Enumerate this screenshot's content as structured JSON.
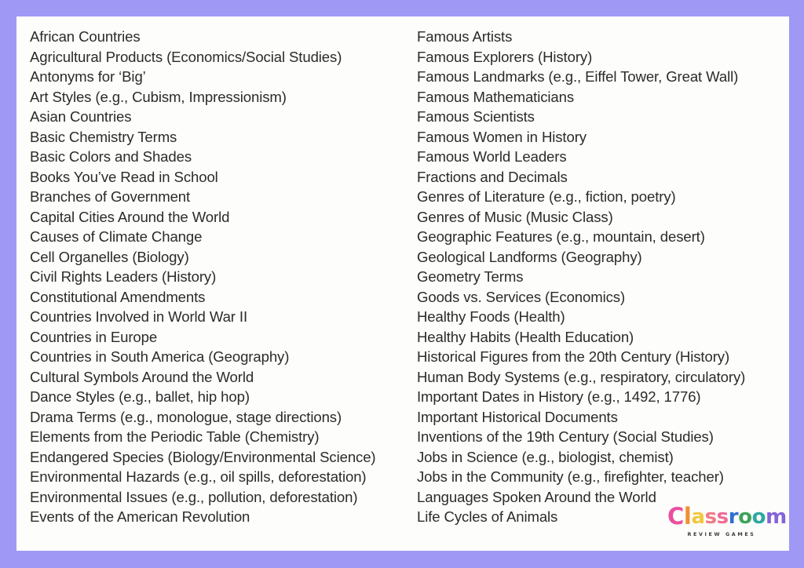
{
  "page": {
    "background_color": "#a098f5",
    "card_color": "#fdfdfb",
    "text_color": "#2b2b2b"
  },
  "columns": {
    "left": [
      "African Countries",
      "Agricultural Products (Economics/Social Studies)",
      "Antonyms for ‘Big’",
      "Art Styles (e.g., Cubism, Impressionism)",
      "Asian Countries",
      "Basic Chemistry Terms",
      "Basic Colors and Shades",
      "Books You’ve Read in School",
      "Branches of Government",
      "Capital Cities Around the World",
      "Causes of Climate Change",
      "Cell Organelles (Biology)",
      "Civil Rights Leaders (History)",
      "Constitutional Amendments",
      "Countries Involved in World War II",
      "Countries in Europe",
      "Countries in South America (Geography)",
      "Cultural Symbols Around the World",
      "Dance Styles (e.g., ballet, hip hop)",
      "Drama Terms (e.g., monologue, stage directions)",
      "Elements from the Periodic Table (Chemistry)",
      "Endangered Species (Biology/Environmental Science)",
      "Environmental Hazards (e.g., oil spills, deforestation)",
      "Environmental Issues (e.g., pollution, deforestation)",
      "Events of the American Revolution"
    ],
    "right": [
      "Famous Artists",
      "Famous Explorers (History)",
      "Famous Landmarks (e.g., Eiffel Tower, Great Wall)",
      "Famous Mathematicians",
      "Famous Scientists",
      "Famous Women in History",
      "Famous World Leaders",
      "Fractions and Decimals",
      "Genres of Literature (e.g., fiction, poetry)",
      "Genres of Music (Music Class)",
      "Geographic Features (e.g., mountain, desert)",
      "Geological Landforms (Geography)",
      "Geometry Terms",
      "Goods vs. Services (Economics)",
      "Healthy Foods (Health)",
      "Healthy Habits (Health Education)",
      "Historical Figures from the 20th Century (History)",
      "Human Body Systems (e.g., respiratory, circulatory)",
      "Important Dates in History (e.g., 1492, 1776)",
      "Important Historical Documents",
      "Inventions of the 19th Century (Social Studies)",
      "Jobs in Science (e.g., biologist, chemist)",
      "Jobs in the Community (e.g., firefighter, teacher)",
      "Languages Spoken Around the World",
      "Life Cycles of Animals"
    ]
  },
  "logo": {
    "word": "Classroom",
    "tagline": "REVIEW GAMES",
    "letters": [
      {
        "char": "C",
        "color": "#ea4f9e",
        "tall": true
      },
      {
        "char": "l",
        "color": "#f0902f",
        "tall": true
      },
      {
        "char": "a",
        "color": "#f2c73c",
        "tall": false
      },
      {
        "char": "s",
        "color": "#f07a84",
        "tall": false
      },
      {
        "char": "s",
        "color": "#ef6b93",
        "tall": false
      },
      {
        "char": "r",
        "color": "#2f6fd0",
        "tall": false
      },
      {
        "char": "o",
        "color": "#3fa35a",
        "tall": false
      },
      {
        "char": "o",
        "color": "#2fa8a0",
        "tall": false
      },
      {
        "char": "m",
        "color": "#8464d8",
        "tall": false
      }
    ]
  }
}
